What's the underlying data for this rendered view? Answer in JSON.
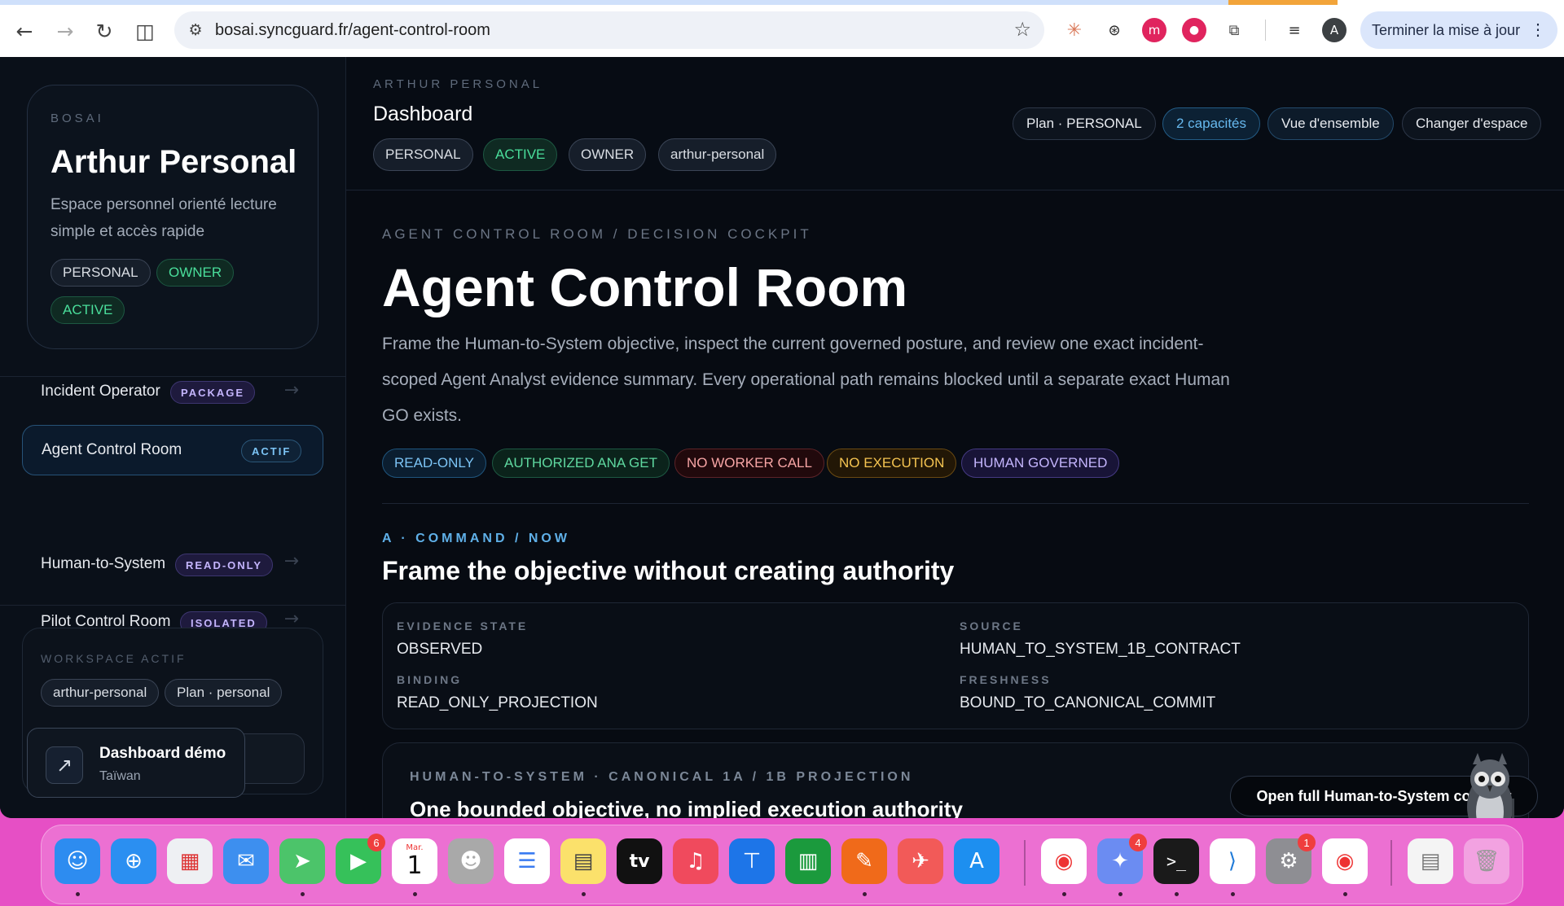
{
  "browser": {
    "url": "bosai.syncguard.fr/agent-control-room",
    "update_label": "Terminer la mise à jour",
    "profile_initial": "A",
    "nav_icons": [
      "back-icon",
      "forward-icon",
      "reload-icon",
      "split-view-icon"
    ],
    "extension_icons": [
      "claude-icon",
      "chatgpt-icon",
      "m-extension-icon",
      "bug-extension-icon",
      "puzzle-icon",
      "reading-list-icon"
    ]
  },
  "sidebar": {
    "workspace": {
      "kicker": "BOSAI",
      "title": "Arthur Personal",
      "description": "Espace personnel orienté lecture simple et accès rapide",
      "badges": [
        "PERSONAL",
        "OWNER",
        "ACTIVE"
      ]
    },
    "nav": [
      {
        "label": "Incident Operator",
        "badge": "PACKAGE"
      },
      {
        "label": "Agent Control Room",
        "badge": "ACTIF"
      },
      {
        "label": "Human-to-System",
        "badge": "READ-ONLY"
      },
      {
        "label": "Pilot Control Room",
        "badge": "ISOLATED"
      }
    ],
    "active_ws": {
      "kicker": "WORKSPACE ACTIF",
      "chips": [
        "arthur-personal",
        "Plan · personal"
      ]
    },
    "demo": {
      "title": "Dashboard démo",
      "subtitle": "Taïwan"
    }
  },
  "topbar": {
    "kicker": "ARTHUR PERSONAL",
    "title": "Dashboard",
    "chips": [
      "PERSONAL",
      "ACTIVE",
      "OWNER",
      "arthur-personal"
    ],
    "actions": [
      "Plan · PERSONAL",
      "2 capacités",
      "Vue d'ensemble",
      "Changer d'espace"
    ]
  },
  "main": {
    "crumb": "AGENT CONTROL ROOM / DECISION COCKPIT",
    "title": "Agent Control Room",
    "lede": "Frame the Human-to-System objective, inspect the current governed posture, and review one exact incident-scoped Agent Analyst evidence summary. Every operational path remains blocked until a separate exact Human GO exists.",
    "tags": [
      "READ-ONLY",
      "AUTHORIZED ANA GET",
      "NO WORKER CALL",
      "NO EXECUTION",
      "HUMAN GOVERNED"
    ],
    "section_kicker": "A · COMMAND / NOW",
    "section_title": "Frame the objective without creating authority",
    "grid": [
      {
        "key": "EVIDENCE STATE",
        "value": "OBSERVED"
      },
      {
        "key": "SOURCE",
        "value": "HUMAN_TO_SYSTEM_1B_CONTRACT"
      },
      {
        "key": "BINDING",
        "value": "READ_ONLY_PROJECTION"
      },
      {
        "key": "FRESHNESS",
        "value": "BOUND_TO_CANONICAL_COMMIT"
      }
    ],
    "projection": {
      "kicker": "HUMAN-TO-SYSTEM · CANONICAL 1A / 1B PROJECTION",
      "title": "One bounded objective, no implied execution authority",
      "open_label": "Open full Human-to-System contract"
    }
  },
  "dock": {
    "badges": {
      "facetime": "6",
      "tweeten": "4",
      "settings": "1"
    },
    "calendar_month": "Mar.",
    "calendar_day": "1",
    "tv_label": "tv",
    "terminal_label": ">_"
  },
  "colors": {
    "accent_blue": "#5fb0e8",
    "success": "#4ade9b",
    "danger": "#f7a5a5",
    "warning": "#f5c451",
    "purple": "#c4b5fd"
  }
}
